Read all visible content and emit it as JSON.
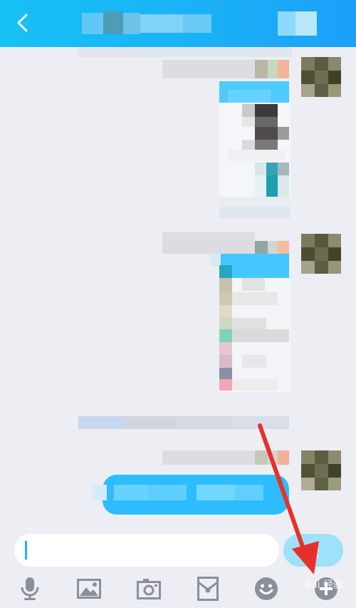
{
  "header": {
    "title": "",
    "back_icon": "chevron-left-icon",
    "background": "#1ab2f7"
  },
  "input": {
    "value": "",
    "placeholder": ""
  },
  "send_label": "送",
  "toolbar": [
    {
      "name": "voice",
      "icon": "microphone-icon"
    },
    {
      "name": "image",
      "icon": "image-icon"
    },
    {
      "name": "camera",
      "icon": "camera-icon"
    },
    {
      "name": "red-packet",
      "icon": "red-packet-icon"
    },
    {
      "name": "emoji",
      "icon": "emoji-icon"
    },
    {
      "name": "more",
      "icon": "more-icon"
    }
  ],
  "watermark": "Bai 经验",
  "colors": {
    "accent": "#1ab2f7",
    "arrow": "#e8302b",
    "bubble": "#3cc3ff"
  }
}
